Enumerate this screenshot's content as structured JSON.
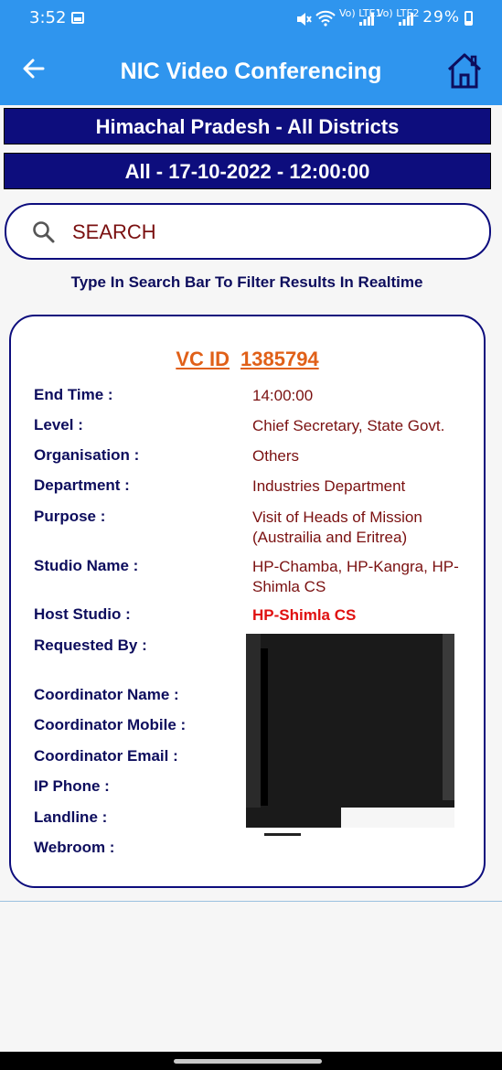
{
  "status": {
    "time": "3:52",
    "battery": "29%",
    "sim1": "Vo) LTE1",
    "sim2": "Vo) LTE2"
  },
  "appbar": {
    "title": "NIC Video Conferencing"
  },
  "banners": {
    "region": "Himachal Pradesh - All Districts",
    "datetime": "All - 17-10-2022 - 12:00:00"
  },
  "search": {
    "placeholder": "SEARCH",
    "hint": "Type In Search Bar To Filter Results In Realtime"
  },
  "card": {
    "vcid_label": "VC ID",
    "vcid_value": "1385794",
    "fields": [
      {
        "label": "End Time :",
        "value": "14:00:00"
      },
      {
        "label": "Level :",
        "value": "Chief Secretary, State Govt."
      },
      {
        "label": "Organisation :",
        "value": "Others"
      },
      {
        "label": "Department :",
        "value": "Industries Department"
      },
      {
        "label": "Purpose :",
        "value": "Visit of Heads of Mission (Austrailia and Eritrea)"
      },
      {
        "label": "Studio Name :",
        "value": "HP-Chamba, HP-Kangra, HP-Shimla CS"
      },
      {
        "label": "Host Studio :",
        "value": "HP-Shimla CS"
      },
      {
        "label": "Requested By :",
        "value": ""
      },
      {
        "label": "Coordinator Name :",
        "value": ""
      },
      {
        "label": "Coordinator Mobile :",
        "value": ""
      },
      {
        "label": "Coordinator Email :",
        "value": ""
      },
      {
        "label": "IP Phone :",
        "value": ""
      },
      {
        "label": "Landline :",
        "value": ""
      },
      {
        "label": "Webroom :",
        "value": ""
      }
    ]
  }
}
